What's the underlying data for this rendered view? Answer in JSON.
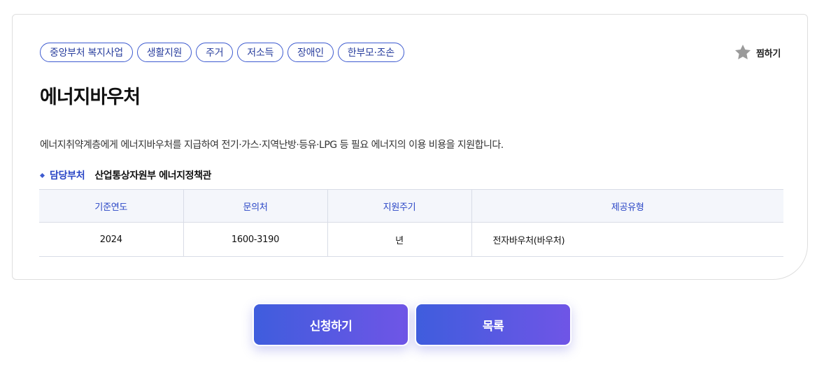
{
  "tags": [
    "중앙부처 복지사업",
    "생활지원",
    "주거",
    "저소득",
    "장애인",
    "한부모·조손"
  ],
  "favorite": {
    "label": "찜하기",
    "icon": "star-icon",
    "icon_color": "#9a9a9a"
  },
  "title": "에너지바우처",
  "description": "에너지취약계층에게 에너지바우처를 지급하여 전기·가스·지역난방·등유·LPG 등 필요 에너지의 이용 비용을 지원합니다.",
  "department": {
    "label": "담당부처",
    "value": "산업통상자원부 에너지정책관"
  },
  "info_table": {
    "headers": [
      "기준연도",
      "문의처",
      "지원주기",
      "제공유형"
    ],
    "row": [
      "2024",
      "1600-3190",
      "년",
      "전자바우처(바우처)"
    ]
  },
  "buttons": {
    "apply": "신청하기",
    "list": "목록"
  },
  "colors": {
    "accent": "#3e5bd0",
    "gradient_start": "#3f5ddd",
    "gradient_end": "#6f55e6"
  }
}
